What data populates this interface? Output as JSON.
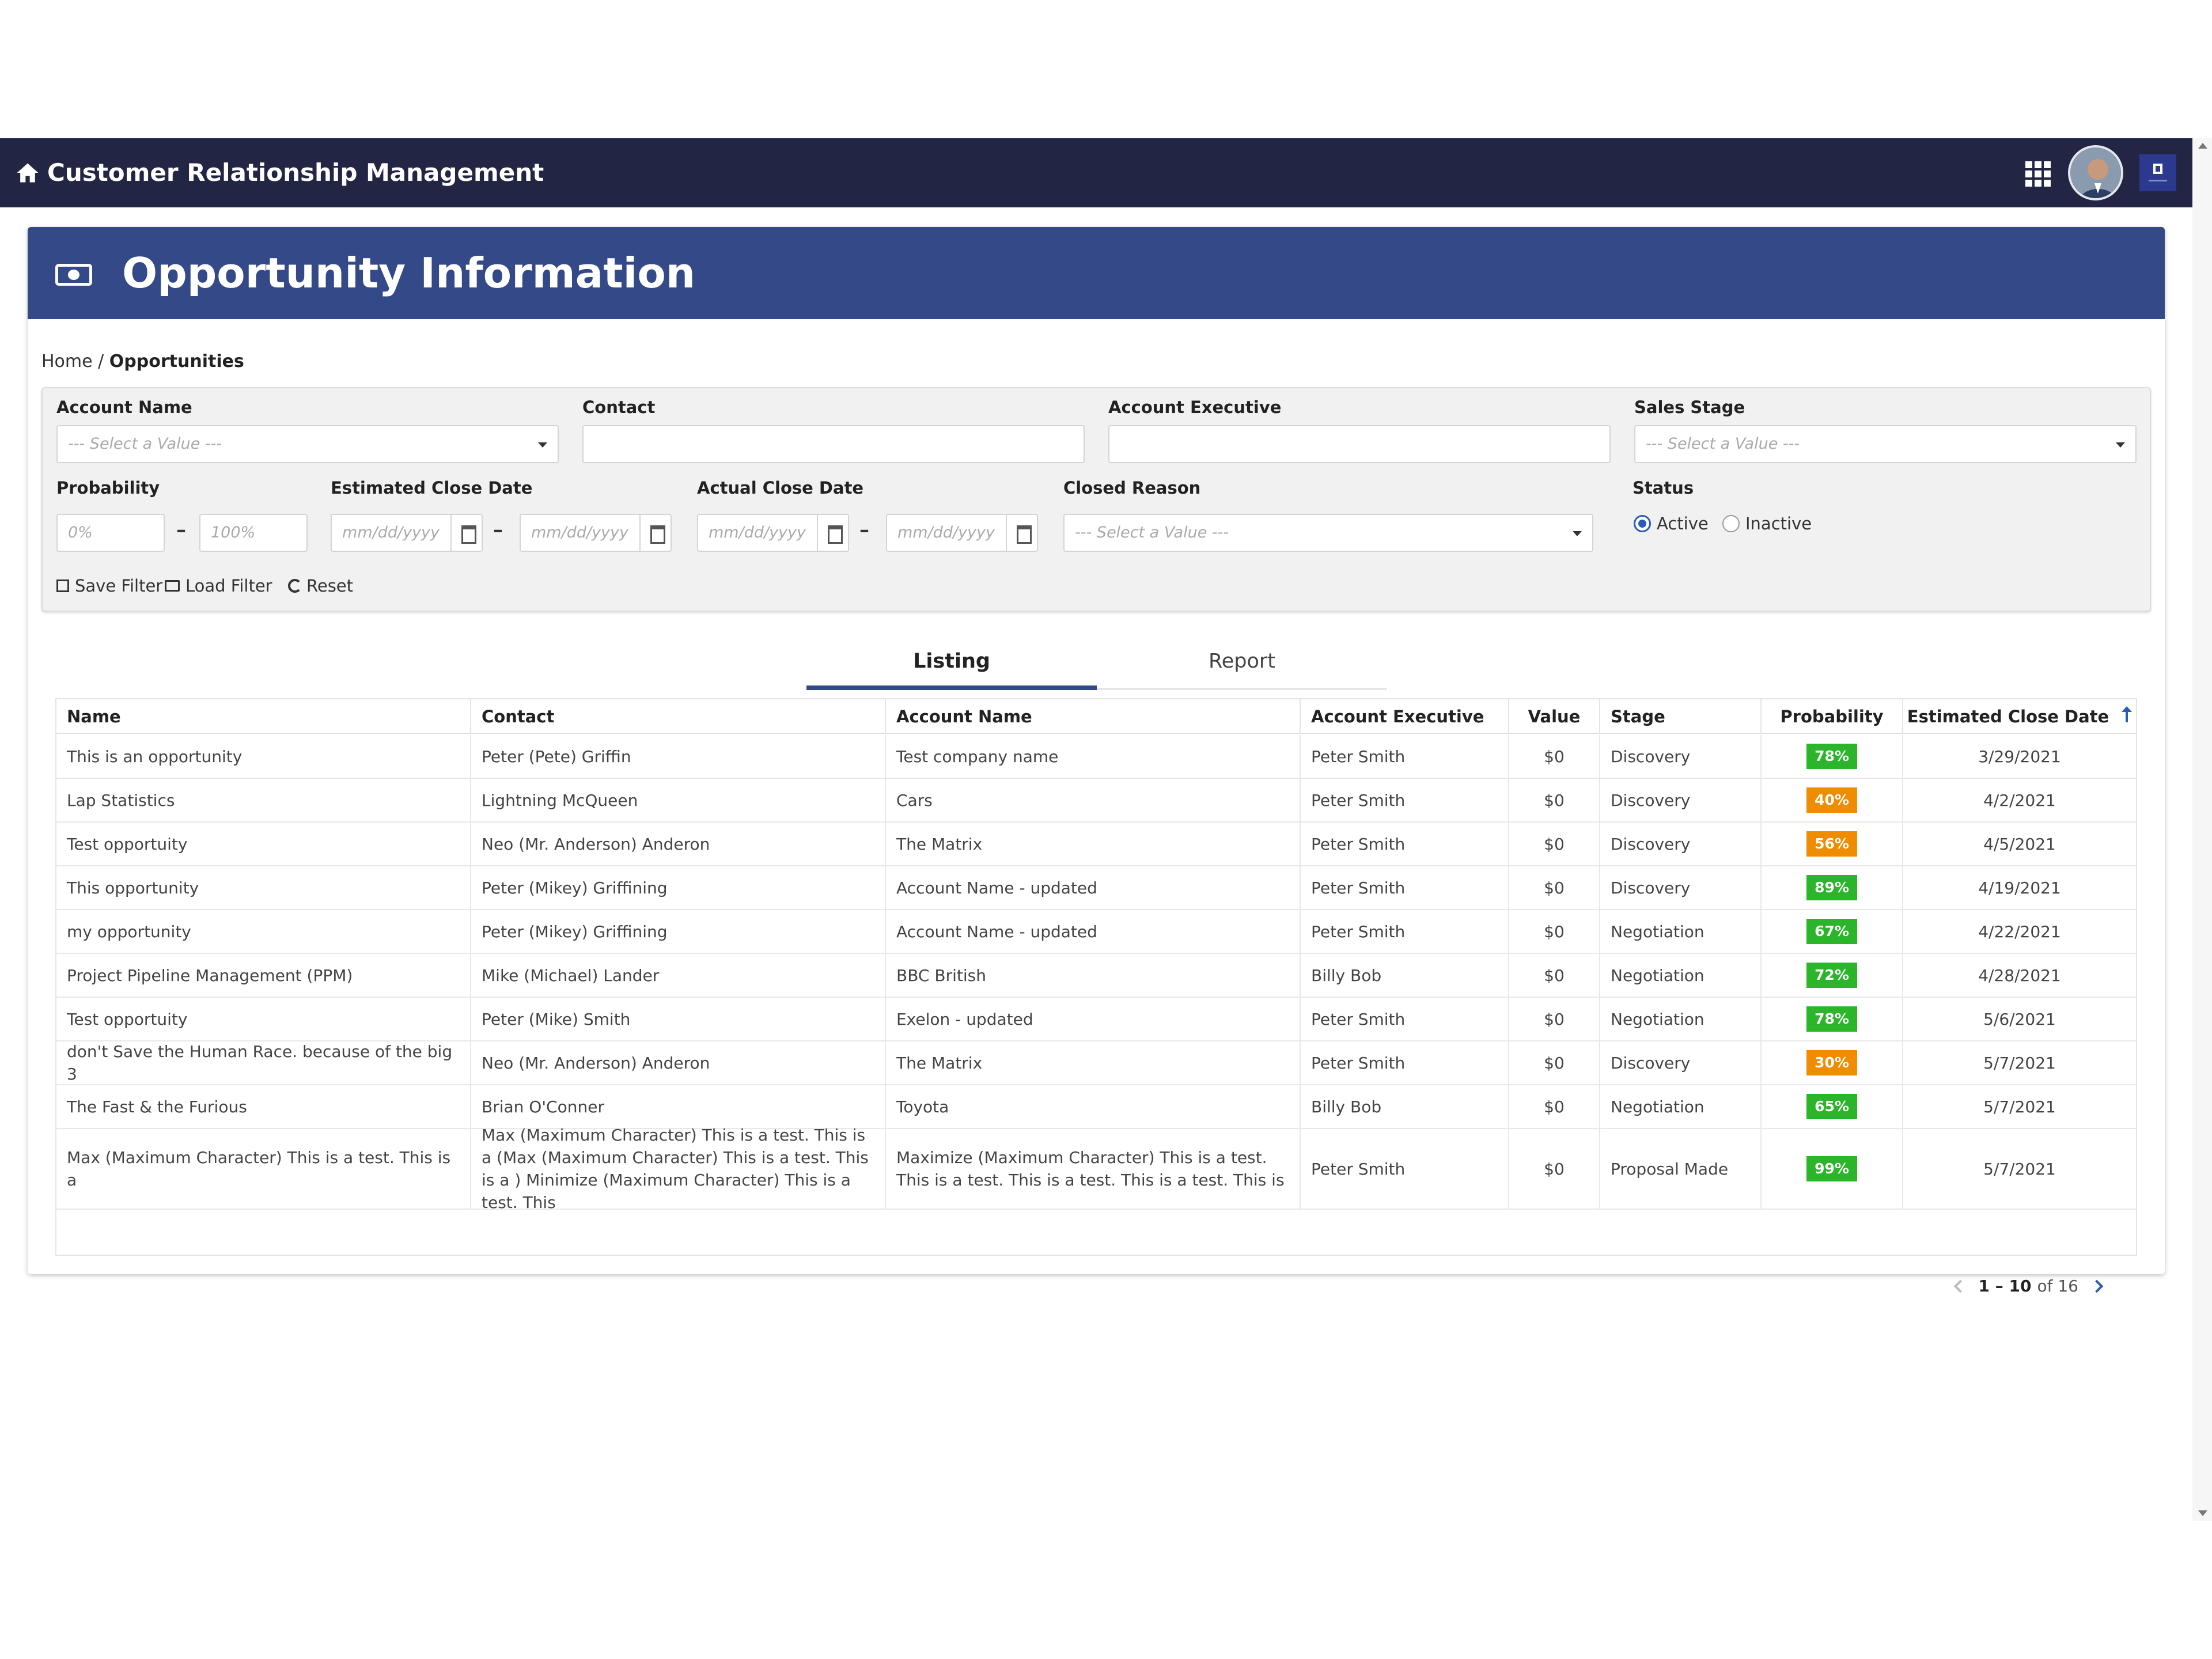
{
  "app": {
    "title": "Customer Relationship Management"
  },
  "page": {
    "title": "Opportunity Information"
  },
  "breadcrumb": {
    "home": "Home",
    "separator": " / ",
    "current": "Opportunities"
  },
  "filters": {
    "account_name": {
      "label": "Account Name",
      "placeholder": "--- Select a Value ---"
    },
    "contact": {
      "label": "Contact",
      "value": ""
    },
    "account_executive": {
      "label": "Account Executive",
      "value": ""
    },
    "sales_stage": {
      "label": "Sales Stage",
      "placeholder": "--- Select a Value ---"
    },
    "probability": {
      "label": "Probability",
      "min_placeholder": "0%",
      "max_placeholder": "100%"
    },
    "estimated_close_date": {
      "label": "Estimated Close Date",
      "from_placeholder": "mm/dd/yyyy",
      "to_placeholder": "mm/dd/yyyy"
    },
    "actual_close_date": {
      "label": "Actual Close Date",
      "from_placeholder": "mm/dd/yyyy",
      "to_placeholder": "mm/dd/yyyy"
    },
    "closed_reason": {
      "label": "Closed Reason",
      "placeholder": "--- Select a Value ---"
    },
    "status": {
      "label": "Status",
      "options": [
        "Active",
        "Inactive"
      ],
      "selected": "Active"
    },
    "range_separator": "–",
    "actions": {
      "save": "Save Filter",
      "load": "Load Filter",
      "reset": "Reset"
    }
  },
  "tabs": [
    {
      "label": "Listing",
      "active": true
    },
    {
      "label": "Report",
      "active": false
    }
  ],
  "table": {
    "columns": [
      "Name",
      "Contact",
      "Account Name",
      "Account Executive",
      "Value",
      "Stage",
      "Probability",
      "Estimated Close Date"
    ],
    "sorted_column": "Estimated Close Date",
    "rows": [
      {
        "name": "This is an opportunity",
        "contact": "Peter (Pete) Griffin",
        "account": "Test company name",
        "exec": "Peter Smith",
        "value": "$0",
        "stage": "Discovery",
        "probability": "78%",
        "prob_color": "green",
        "close_date": "3/29/2021"
      },
      {
        "name": "Lap Statistics",
        "contact": "Lightning McQueen",
        "account": "Cars",
        "exec": "Peter Smith",
        "value": "$0",
        "stage": "Discovery",
        "probability": "40%",
        "prob_color": "orange",
        "close_date": "4/2/2021"
      },
      {
        "name": "Test opportuity",
        "contact": "Neo (Mr. Anderson) Anderon",
        "account": "The Matrix",
        "exec": "Peter Smith",
        "value": "$0",
        "stage": "Discovery",
        "probability": "56%",
        "prob_color": "orange",
        "close_date": "4/5/2021"
      },
      {
        "name": "This opportunity",
        "contact": "Peter (Mikey) Griffining",
        "account": "Account Name - updated",
        "exec": "Peter Smith",
        "value": "$0",
        "stage": "Discovery",
        "probability": "89%",
        "prob_color": "green",
        "close_date": "4/19/2021"
      },
      {
        "name": "my opportunity",
        "contact": "Peter (Mikey) Griffining",
        "account": "Account Name - updated",
        "exec": "Peter Smith",
        "value": "$0",
        "stage": "Negotiation",
        "probability": "67%",
        "prob_color": "green",
        "close_date": "4/22/2021"
      },
      {
        "name": "Project Pipeline Management (PPM)",
        "contact": "Mike (Michael) Lander",
        "account": "BBC British",
        "exec": "Billy Bob",
        "value": "$0",
        "stage": "Negotiation",
        "probability": "72%",
        "prob_color": "green",
        "close_date": "4/28/2021"
      },
      {
        "name": "Test opportuity",
        "contact": "Peter (Mike) Smith",
        "account": "Exelon - updated",
        "exec": "Peter Smith",
        "value": "$0",
        "stage": "Negotiation",
        "probability": "78%",
        "prob_color": "green",
        "close_date": "5/6/2021"
      },
      {
        "name": "don't Save the Human Race. because of the big 3",
        "contact": "Neo (Mr. Anderson) Anderon",
        "account": "The Matrix",
        "exec": "Peter Smith",
        "value": "$0",
        "stage": "Discovery",
        "probability": "30%",
        "prob_color": "orange",
        "close_date": "5/7/2021"
      },
      {
        "name": "The Fast & the Furious",
        "contact": "Brian O'Conner",
        "account": "Toyota",
        "exec": "Billy Bob",
        "value": "$0",
        "stage": "Negotiation",
        "probability": "65%",
        "prob_color": "green",
        "close_date": "5/7/2021"
      },
      {
        "name": "Max (Maximum Character) This is a test. This is a",
        "contact": "Max (Maximum Character) This is a test. This is a (Max (Maximum Character) This is a test. This is a ) Minimize (Maximum Character) This is a test. This",
        "account": "Maximize (Maximum Character) This is a test. This is a test. This is a test. This is a test. This is",
        "exec": "Peter Smith",
        "value": "$0",
        "stage": "Proposal Made",
        "probability": "99%",
        "prob_color": "green",
        "close_date": "5/7/2021"
      }
    ]
  },
  "pagination": {
    "range": "1 – 10",
    "of_label": "of",
    "total": "16"
  },
  "colors": {
    "topbar": "#232544",
    "header": "#334988",
    "badge_green": "#2ab52a",
    "badge_orange": "#f08c00",
    "accent": "#2b5cb8"
  },
  "icons": {
    "home": "home-icon",
    "apps": "grid-icon",
    "money": "money-icon",
    "calendar": "calendar-icon",
    "save": "save-icon",
    "load": "folder-icon",
    "reset": "reset-icon",
    "sort": "sort-up-icon"
  }
}
